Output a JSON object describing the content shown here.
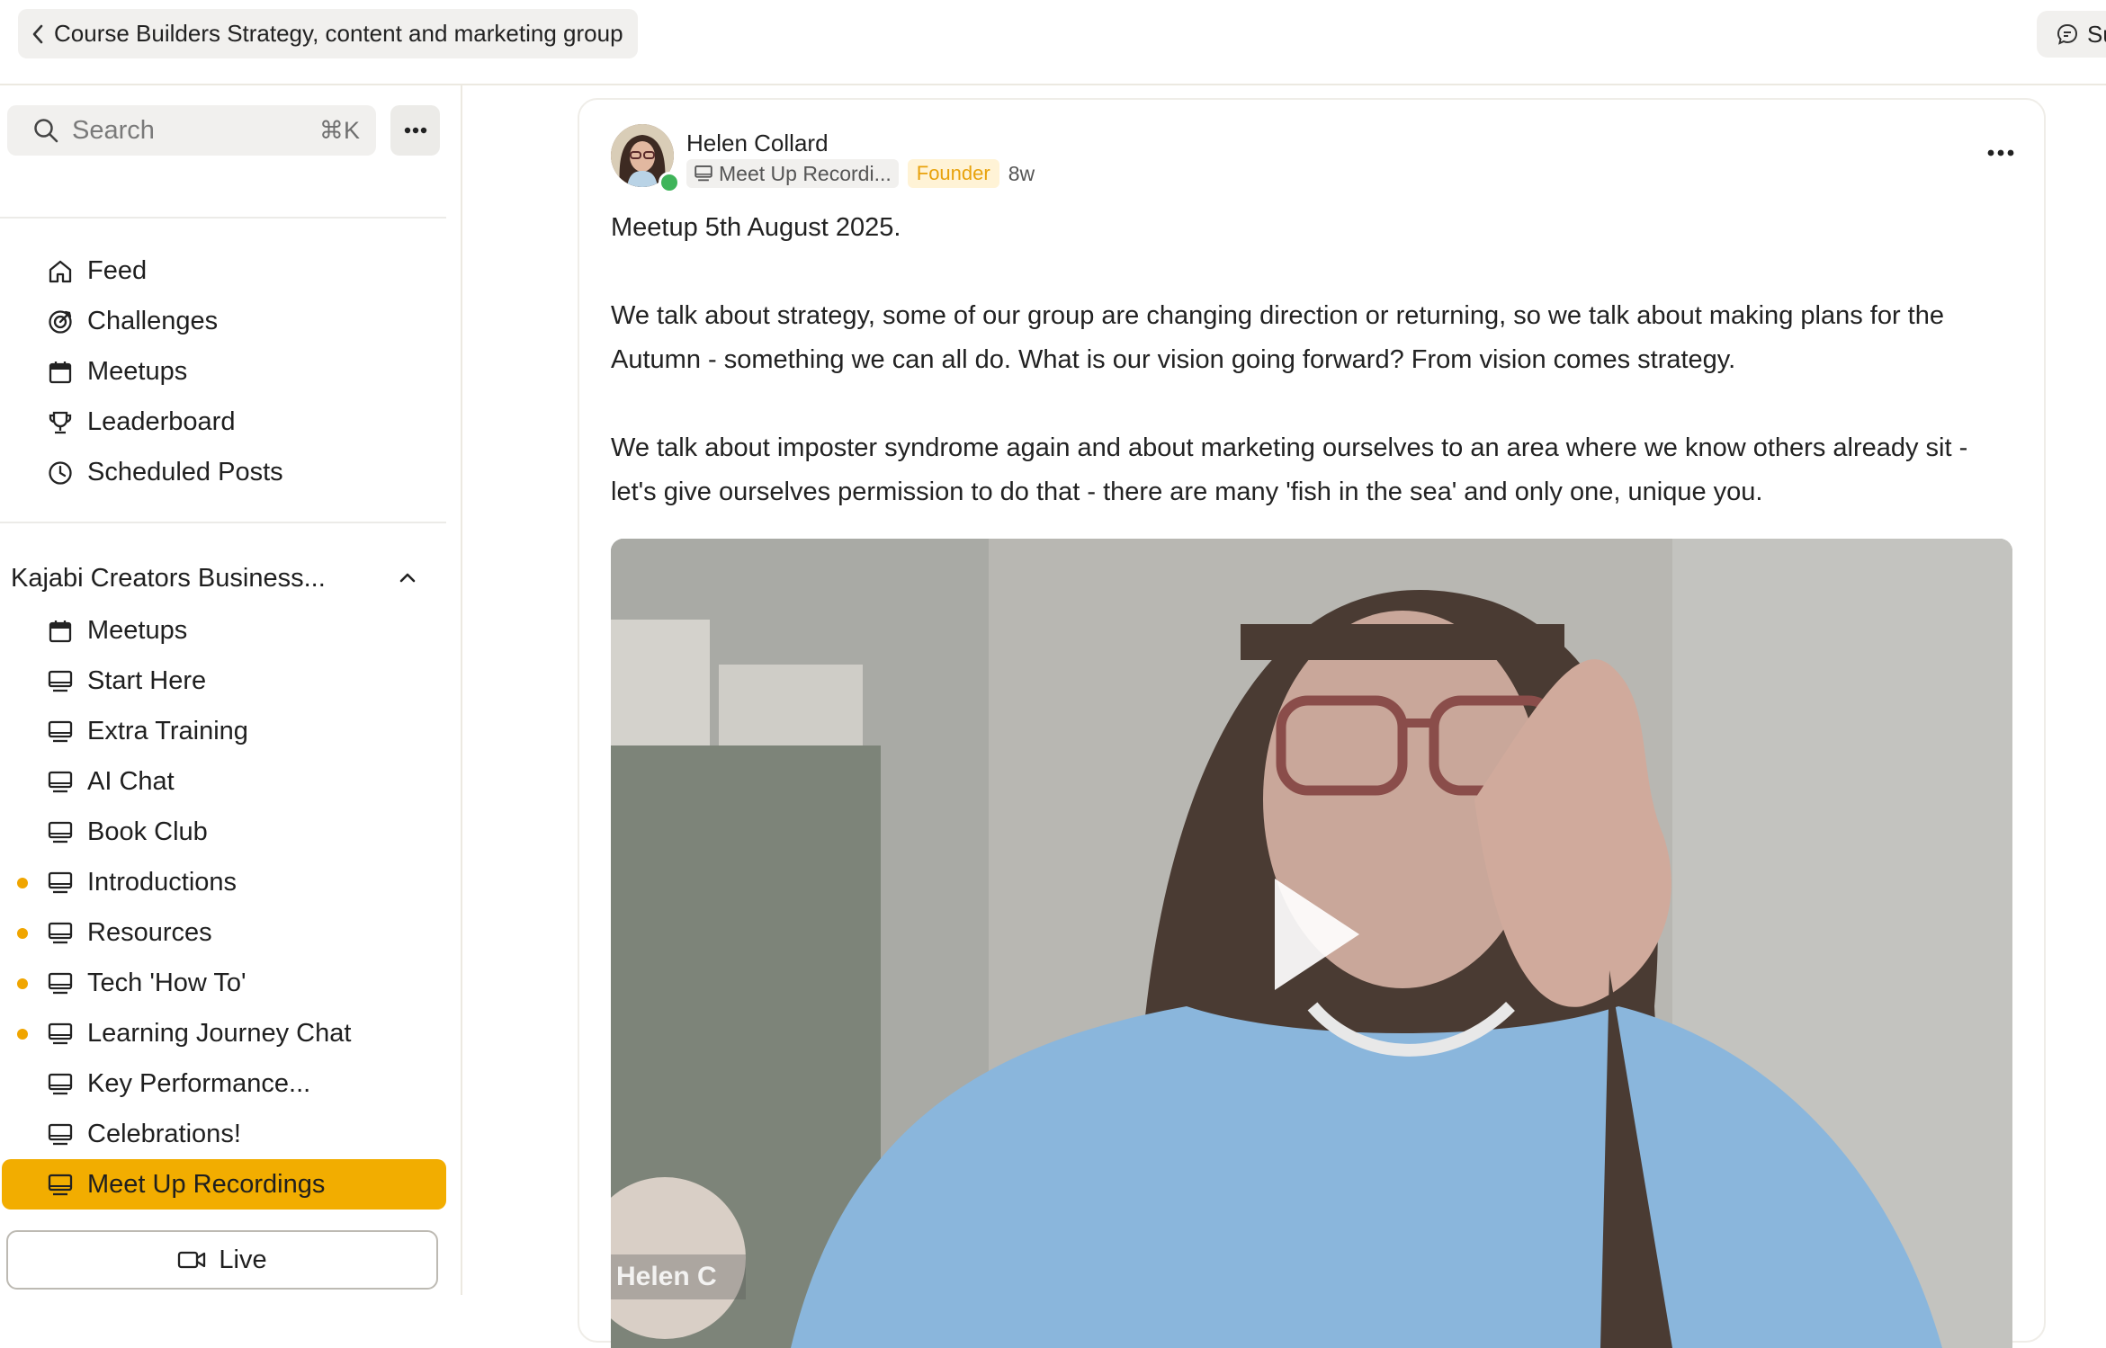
{
  "topbar": {
    "back_label": "Course Builders Strategy, content and marketing group",
    "support_label": "Su"
  },
  "sidebar": {
    "search_placeholder": "Search",
    "search_shortcut": "⌘K",
    "main_nav": [
      {
        "label": "Feed",
        "icon": "home-icon"
      },
      {
        "label": "Challenges",
        "icon": "target-icon"
      },
      {
        "label": "Meetups",
        "icon": "calendar-icon"
      },
      {
        "label": "Leaderboard",
        "icon": "trophy-icon"
      },
      {
        "label": "Scheduled Posts",
        "icon": "clock-icon"
      }
    ],
    "section_title": "Kajabi Creators Business...",
    "section_items": [
      {
        "label": "Meetups",
        "icon": "calendar-icon",
        "unread": false
      },
      {
        "label": "Start Here",
        "icon": "monitor-icon",
        "unread": false
      },
      {
        "label": "Extra Training",
        "icon": "monitor-icon",
        "unread": false
      },
      {
        "label": "AI Chat",
        "icon": "monitor-icon",
        "unread": false
      },
      {
        "label": "Book Club",
        "icon": "monitor-icon",
        "unread": false
      },
      {
        "label": "Introductions",
        "icon": "monitor-icon",
        "unread": true
      },
      {
        "label": "Resources",
        "icon": "monitor-icon",
        "unread": true
      },
      {
        "label": "Tech 'How To'",
        "icon": "monitor-icon",
        "unread": true
      },
      {
        "label": "Learning Journey Chat",
        "icon": "monitor-icon",
        "unread": true
      },
      {
        "label": "Key Performance...",
        "icon": "monitor-icon",
        "unread": false
      },
      {
        "label": "Celebrations!",
        "icon": "monitor-icon",
        "unread": false
      },
      {
        "label": "Meet Up Recordings",
        "icon": "monitor-icon",
        "unread": false,
        "active": true
      }
    ],
    "live_label": "Live"
  },
  "post": {
    "author": "Helen Collard",
    "space": "Meet Up Recordi...",
    "role": "Founder",
    "time": "8w",
    "paragraphs": [
      "Meetup 5th August 2025.",
      "We talk about strategy, some of our group are changing direction or returning, so we talk about making plans for the Autumn - something we can all do. What is our vision going forward? From vision comes strategy.",
      "We talk about imposter syndrome again and about marketing ourselves to an area where we know others already sit - let's give ourselves permission to do that - there are many 'fish in the sea' and only one, unique you."
    ],
    "video_name_tag": "Helen C"
  },
  "colors": {
    "accent": "#f2ad00",
    "unread_dot": "#f0a500",
    "founder_text": "#e8a20c",
    "online": "#3fb45a"
  }
}
